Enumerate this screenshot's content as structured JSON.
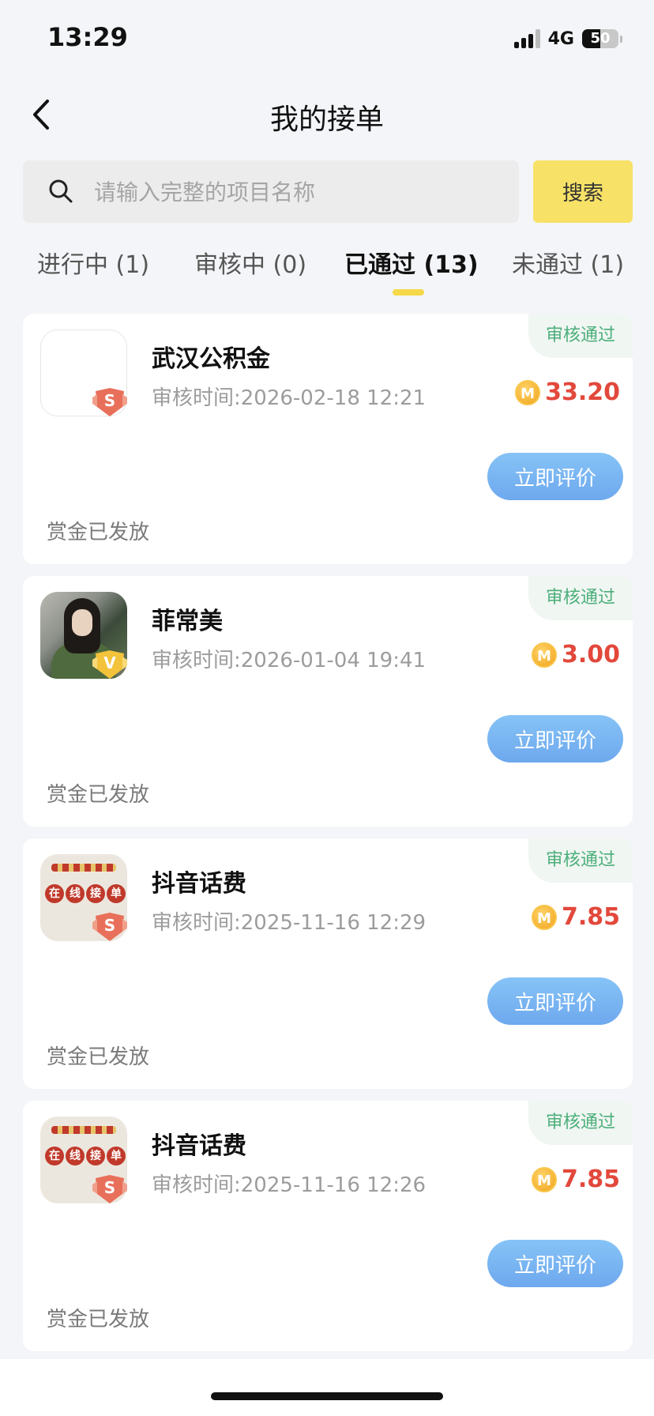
{
  "status_bar": {
    "time": "13:29",
    "network": "4G",
    "battery": "50",
    "battery_level": 0.5
  },
  "nav": {
    "title": "我的接单"
  },
  "search": {
    "placeholder": "请输入完整的项目名称",
    "button_label": "搜索"
  },
  "tabs": [
    {
      "label": "进行中 (1)",
      "active": false
    },
    {
      "label": "审核中 (0)",
      "active": false
    },
    {
      "label": "已通过 (13)",
      "active": true
    },
    {
      "label": "未通过 (1)",
      "active": false
    }
  ],
  "orders": [
    {
      "title": "武汉公积金",
      "review_time": "审核时间:2026-02-18 12:21",
      "amount": "33.20",
      "status": "审核通过",
      "action_label": "立即评价",
      "footer": "赏金已发放",
      "badge": "S",
      "badge_color": "#e8705a",
      "thumb": "blank"
    },
    {
      "title": "菲常美",
      "review_time": "审核时间:2026-01-04 19:41",
      "amount": "3.00",
      "status": "审核通过",
      "action_label": "立即评价",
      "footer": "赏金已发放",
      "badge": "V",
      "badge_color": "#f2c33b",
      "thumb": "photo"
    },
    {
      "title": "抖音话费",
      "review_time": "审核时间:2025-11-16 12:29",
      "amount": "7.85",
      "status": "审核通过",
      "action_label": "立即评价",
      "footer": "赏金已发放",
      "badge": "S",
      "badge_color": "#e8705a",
      "thumb": "poster"
    },
    {
      "title": "抖音话费",
      "review_time": "审核时间:2025-11-16 12:26",
      "amount": "7.85",
      "status": "审核通过",
      "action_label": "立即评价",
      "footer": "赏金已发放",
      "badge": "S",
      "badge_color": "#e8705a",
      "thumb": "poster"
    }
  ],
  "coin_symbol": "M",
  "thumb_poster_chars": [
    "在",
    "线",
    "接",
    "单"
  ]
}
